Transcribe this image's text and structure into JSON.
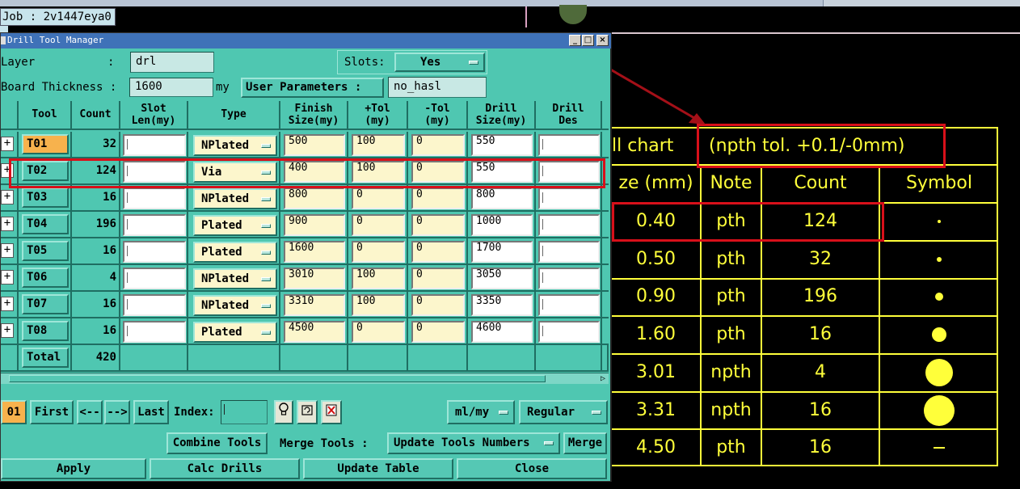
{
  "job_label": "Job : 2v1447eya0",
  "dialog": {
    "title": "Drill Tool Manager",
    "layer_label": "Layer",
    "layer_value": "drl",
    "slots_label": "Slots:",
    "slots_value": "Yes",
    "board_thickness_label": "Board Thickness :",
    "board_thickness_value": "1600",
    "board_thickness_unit": "my",
    "user_params_label": "User Parameters :",
    "user_params_value": "no_hasl",
    "columns": [
      "Tool",
      "Count",
      "Slot\nLen(my)",
      "Type",
      "Finish\nSize(my)",
      "+Tol\n(my)",
      "-Tol\n(my)",
      "Drill\nSize(my)",
      "Drill\nDes"
    ],
    "rows": [
      {
        "tool": "T01",
        "count": "32",
        "type": "NPlated",
        "finish": "500",
        "ptol": "100",
        "mtol": "0",
        "drill": "550"
      },
      {
        "tool": "T02",
        "count": "124",
        "type": "Via",
        "finish": "400",
        "ptol": "100",
        "mtol": "0",
        "drill": "550"
      },
      {
        "tool": "T03",
        "count": "16",
        "type": "NPlated",
        "finish": "800",
        "ptol": "0",
        "mtol": "0",
        "drill": "800"
      },
      {
        "tool": "T04",
        "count": "196",
        "type": "Plated",
        "finish": "900",
        "ptol": "0",
        "mtol": "0",
        "drill": "1000"
      },
      {
        "tool": "T05",
        "count": "16",
        "type": "Plated",
        "finish": "1600",
        "ptol": "0",
        "mtol": "0",
        "drill": "1700"
      },
      {
        "tool": "T06",
        "count": "4",
        "type": "NPlated",
        "finish": "3010",
        "ptol": "100",
        "mtol": "0",
        "drill": "3050"
      },
      {
        "tool": "T07",
        "count": "16",
        "type": "NPlated",
        "finish": "3310",
        "ptol": "100",
        "mtol": "0",
        "drill": "3350"
      },
      {
        "tool": "T08",
        "count": "16",
        "type": "Plated",
        "finish": "4500",
        "ptol": "0",
        "mtol": "0",
        "drill": "4600"
      }
    ],
    "total_label": "Total",
    "total_value": "420",
    "nav": {
      "current": "01",
      "first": "First",
      "prev": "<--",
      "next": "-->",
      "last": "Last",
      "index_label": "Index:",
      "unit": "ml/my",
      "mode": "Regular"
    },
    "buttons": {
      "combine": "Combine Tools",
      "merge_label": "Merge Tools :",
      "update_numbers": "Update Tools Numbers",
      "merge": "Merge",
      "apply": "Apply",
      "calc": "Calc Drills",
      "update_table": "Update Table",
      "close": "Close"
    }
  },
  "chart": {
    "title": "ll chart",
    "note": "(npth tol. +0.1/-0mm)",
    "headers": [
      "ze (mm)",
      "Note",
      "Count",
      "Symbol"
    ],
    "rows": [
      {
        "size": "0.40",
        "note": "pth",
        "count": "124",
        "sym": "dot-xs"
      },
      {
        "size": "0.50",
        "note": "pth",
        "count": "32",
        "sym": "dot-s"
      },
      {
        "size": "0.90",
        "note": "pth",
        "count": "196",
        "sym": "dot-m"
      },
      {
        "size": "1.60",
        "note": "pth",
        "count": "16",
        "sym": "dot-l"
      },
      {
        "size": "3.01",
        "note": "npth",
        "count": "4",
        "sym": "dot-xl"
      },
      {
        "size": "3.31",
        "note": "npth",
        "count": "16",
        "sym": "dot-xxl"
      },
      {
        "size": "4.50",
        "note": "pth",
        "count": "16",
        "sym": "dash"
      }
    ],
    "color": "#ffff3a",
    "annotation_color": "#d8101a"
  }
}
